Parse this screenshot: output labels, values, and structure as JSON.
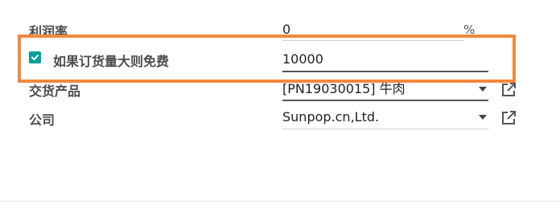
{
  "form": {
    "profit_rate": {
      "label": "利润率",
      "value": "0",
      "unit": "%"
    },
    "free_if_order_large": {
      "label": "如果订货量大则免费",
      "checked": true,
      "value": "10000"
    },
    "delivery_product": {
      "label": "交货产品",
      "value": "[PN19030015] 牛肉"
    },
    "company": {
      "label": "公司",
      "value": "Sunpop.cn,Ltd."
    }
  },
  "colors": {
    "highlight": "#f3883d",
    "checkbox": "#00a09d"
  },
  "icons": {
    "external_link": "external-link-icon",
    "dropdown": "chevron-down-icon",
    "check": "check-icon"
  }
}
